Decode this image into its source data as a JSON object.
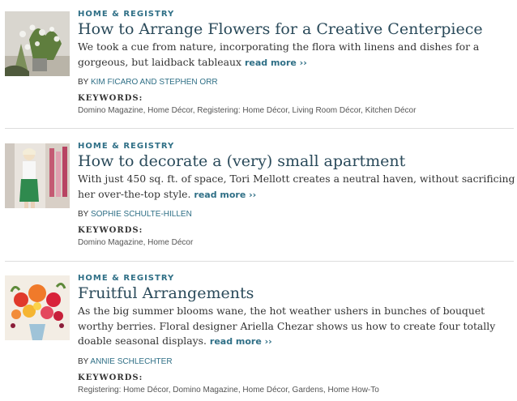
{
  "articles": [
    {
      "category": "HOME & REGISTRY",
      "title": "How to Arrange Flowers for a Creative Centerpiece",
      "description": "We took a cue from nature, incorporating the flora with linens and dishes for a gorgeous, but laidback tableaux",
      "read_more": "read more ››",
      "by_label": "BY",
      "author": "KIM FICARO AND STEPHEN ORR",
      "keywords_label": "KEYWORDS:",
      "keywords": "Domino Magazine, Home Décor, Registering: Home Décor, Living Room Décor, Kitchen Décor",
      "thumbnail_icon": "flower-centerpiece-photo"
    },
    {
      "category": "HOME & REGISTRY",
      "title": "How to decorate a (very) small apartment",
      "description": "With just 450 sq. ft. of space, Tori Mellott creates a neutral haven, without sacrificing her over-the-top style.",
      "read_more": "read more ››",
      "by_label": "BY",
      "author": "SOPHIE SCHULTE-HILLEN",
      "keywords_label": "KEYWORDS:",
      "keywords": "Domino Magazine, Home Décor",
      "thumbnail_icon": "apartment-woman-photo"
    },
    {
      "category": "HOME & REGISTRY",
      "title": "Fruitful Arrangements",
      "description": "As the big summer blooms wane, the hot weather ushers in bunches of bouquet worthy berries. Floral designer Ariella Chezar shows us how to create four totally doable seasonal displays.",
      "read_more": "read more ››",
      "by_label": "BY",
      "author": "ANNIE SCHLECHTER",
      "keywords_label": "KEYWORDS:",
      "keywords": "Registering: Home Décor, Domino Magazine, Home Décor, Gardens, Home How-To",
      "thumbnail_icon": "fruit-bouquet-photo"
    }
  ]
}
